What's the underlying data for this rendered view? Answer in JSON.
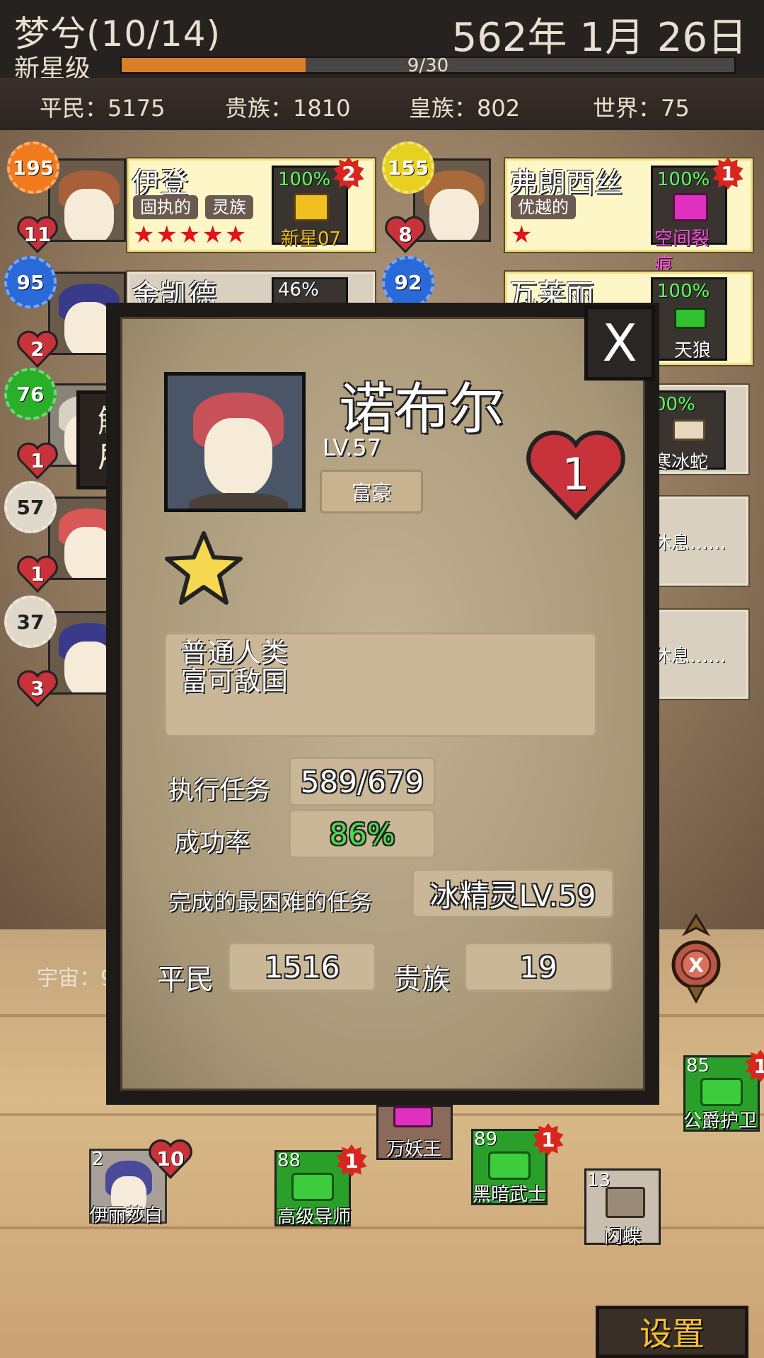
{
  "header": {
    "title": "梦兮(10/14)",
    "date": "562年 1月 26日",
    "rank": "新星级",
    "xp_text": "9/30",
    "xp_progress": 0.3
  },
  "stats": {
    "commoner": "平民：5175",
    "noble": "贵族：1810",
    "royal": "皇族：802",
    "world": "世界：75"
  },
  "heroes": [
    {
      "level": "195",
      "hearts": "11",
      "name": "伊登",
      "traits": [
        "固执的",
        "灵族"
      ],
      "stars": "★★★★★",
      "mission_pct": "100%",
      "mission_name": "新星07",
      "mission_badge": "2",
      "badge_color": "#f07a1c"
    },
    {
      "level": "155",
      "hearts": "8",
      "name": "弗朗西丝",
      "traits": [
        "优越的"
      ],
      "stars": "★",
      "mission_pct": "100%",
      "mission_name": "空间裂痕",
      "mission_badge": "1",
      "badge_color": "#e8d020"
    },
    {
      "level": "95",
      "hearts": "2",
      "name": "金凯德",
      "mission_pct": "46%",
      "badge_color": "#2a6ad8"
    },
    {
      "level": "92",
      "name": "瓦莱丽",
      "mission_pct": "100%",
      "mission_name": "天狼",
      "badge_color": "#2a6ad8"
    },
    {
      "level": "76",
      "hearts": "1",
      "badge_color": "#28b028"
    },
    {
      "mission_pct": "00%",
      "mission_name": "寒冰蛇"
    },
    {
      "level": "57",
      "hearts": "1",
      "badge_color": "#e0d8c8",
      "rest": "休息……"
    },
    {
      "level": "37",
      "hearts": "3",
      "badge_color": "#e0d8c8",
      "rest": "休息……"
    }
  ],
  "dismiss_label": "解雇",
  "modal": {
    "close_label": "X",
    "name": "诺布尔",
    "level": "LV.57",
    "trait": "富豪",
    "hearts": "1",
    "stars": 1,
    "description": [
      "普通人类",
      "富可敌国"
    ],
    "missions_label": "执行任务",
    "missions_value": "589/679",
    "success_label": "成功率",
    "success_value": "86%",
    "hardest_label": "完成的最困难的任务",
    "hardest_value": "冰精灵LV.59",
    "commoner_label": "平民",
    "commoner_value": "1516",
    "noble_label": "贵族",
    "noble_value": "19"
  },
  "cosmos_label": "宇宙：9",
  "bottom_units": [
    {
      "name": "伊丽莎白",
      "level": "2",
      "hearts": "10"
    },
    {
      "name": "高级导师",
      "level": "88",
      "badge": "1"
    },
    {
      "name": "万妖王"
    },
    {
      "name": "黑暗武士",
      "level": "89",
      "badge": "1"
    },
    {
      "name": "闪蝶",
      "level": "13"
    },
    {
      "name": "公爵护卫",
      "level": "85",
      "badge": "1"
    }
  ],
  "settings_label": "设置",
  "colors": {
    "accent_orange": "#d97f2a",
    "success_green": "#4cdc4c",
    "heart_red": "#c8323a",
    "settings_gold": "#f5c030"
  }
}
